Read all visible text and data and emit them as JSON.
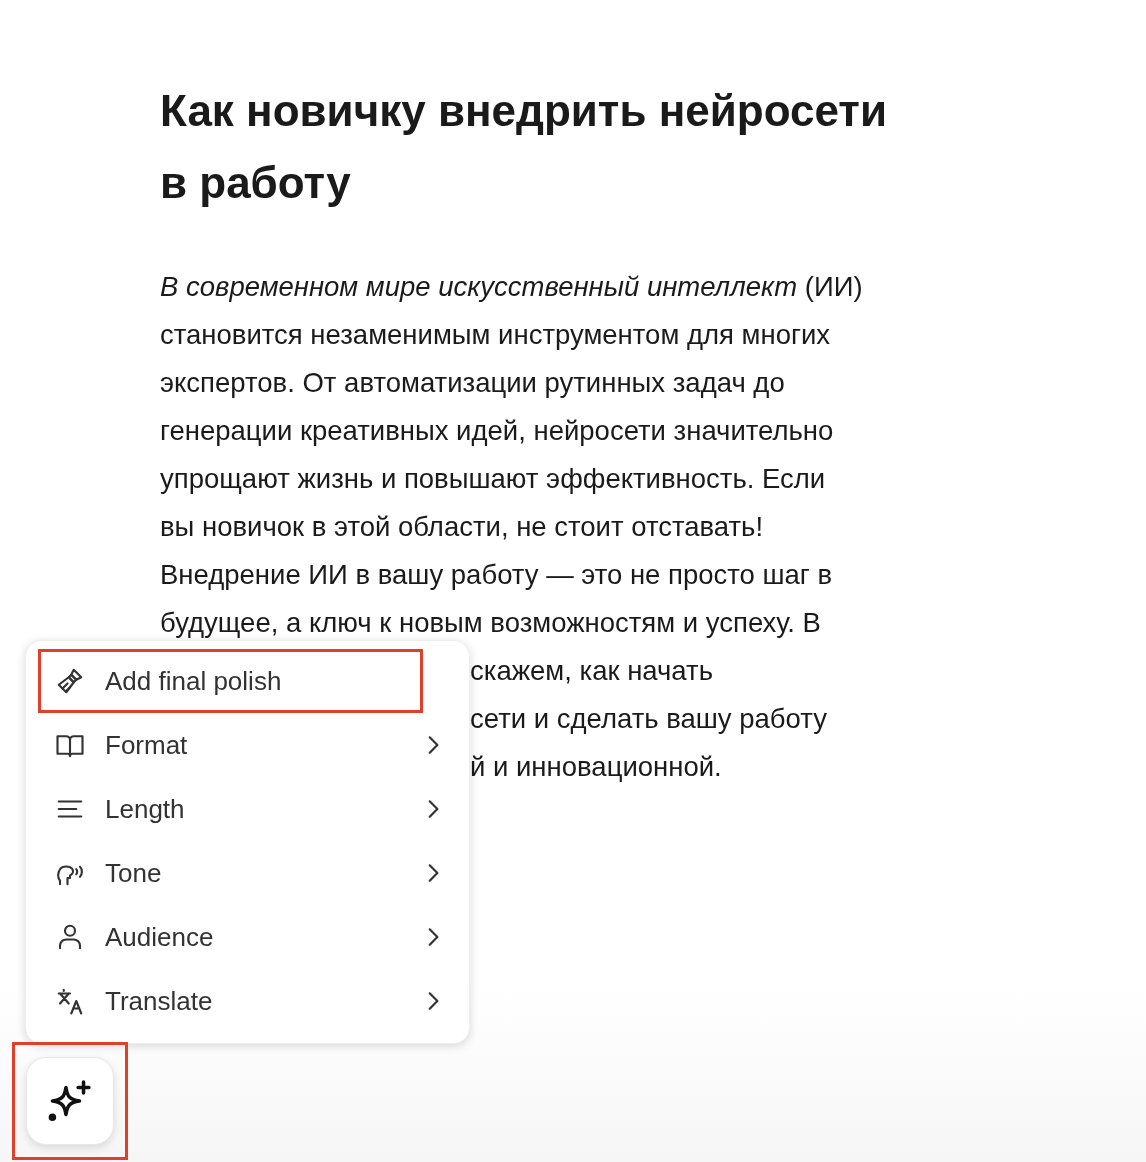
{
  "article": {
    "title_lines": [
      "Как новичку внедрить нейросети",
      "в работу"
    ],
    "paragraph_lines": [
      "*В современном мире искусственный интеллект* (ИИ)",
      "становится незаменимым инструментом для многих",
      "экспертов. От автоматизации рутинных задач до",
      "генерации креативных идей, нейросети значительно",
      "упрощают жизнь и повышают эффективность. Если",
      "вы новичок в этой области, не стоит отставать!",
      "Внедрение ИИ в вашу работу — это не просто шаг в",
      "будущее, а ключ к новым возможностям и успеху. В"
    ],
    "partial_lines": [
      "скажем, как начать",
      "сети и сделать вашу работу",
      "й и инновационной."
    ]
  },
  "menu": {
    "items": [
      {
        "label": "Add final polish",
        "has_submenu": false,
        "highlighted": true
      },
      {
        "label": "Format",
        "has_submenu": true,
        "highlighted": false
      },
      {
        "label": "Length",
        "has_submenu": true,
        "highlighted": false
      },
      {
        "label": "Tone",
        "has_submenu": true,
        "highlighted": false
      },
      {
        "label": "Audience",
        "has_submenu": true,
        "highlighted": false
      },
      {
        "label": "Translate",
        "has_submenu": true,
        "highlighted": false
      }
    ]
  },
  "ai_button": {
    "highlighted": true
  }
}
